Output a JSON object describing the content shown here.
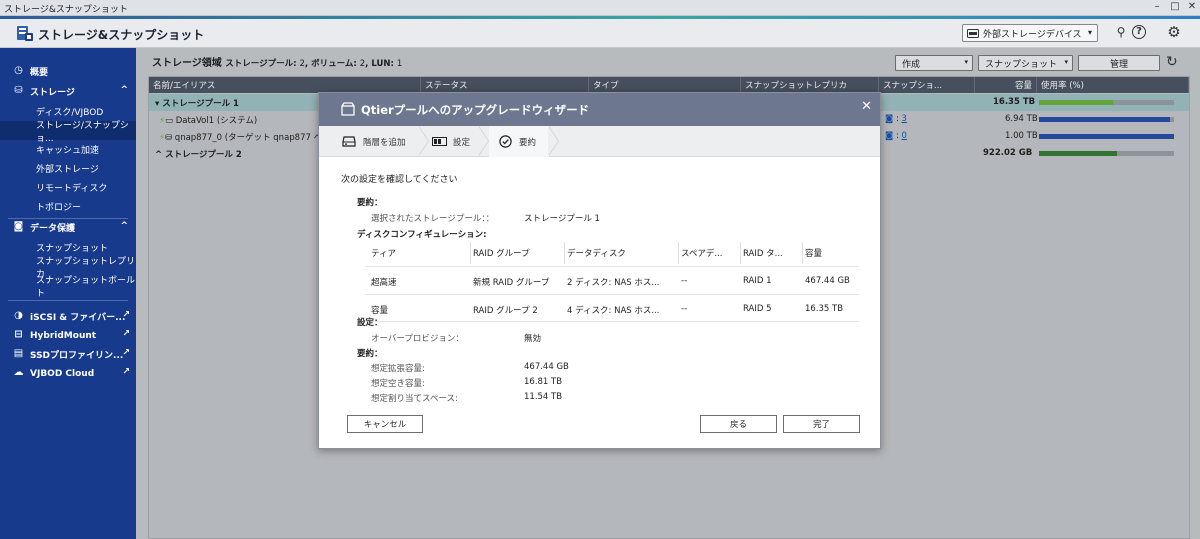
{
  "window": {
    "title": "ストレージ&スナップショット"
  },
  "header": {
    "app_title": "ストレージ&スナップショット",
    "ext_device_label": "外部ストレージデバイス"
  },
  "sidebar": {
    "overview": "概要",
    "storage": "ストレージ",
    "storage_items": [
      "ディスク/VJBOD",
      "ストレージ/スナップショ...",
      "キャッシュ加速",
      "外部ストレージ",
      "リモートディスク",
      "トポロジー"
    ],
    "data_protection": "データ保護",
    "protection_items": [
      "スナップショット",
      "スナップショットレプリカ",
      "スナップショットボールト"
    ],
    "external_items": [
      "iSCSI & ファイバー...",
      "HybridMount",
      "SSDプロファイリン...",
      "VJBOD Cloud"
    ]
  },
  "main": {
    "title": "ストレージ領域",
    "summary_pools_label": "ストレージプール:",
    "summary_pools": "2",
    "summary_volumes_label": "ボリューム:",
    "summary_volumes": "2",
    "summary_luns_label": "LUN:",
    "summary_luns": "1",
    "buttons": {
      "create": "作成",
      "snapshot": "スナップショット",
      "manage": "管理"
    },
    "columns": [
      "名前/エイリアス",
      "ステータス",
      "タイプ",
      "スナップショットレプリカ",
      "スナップショ...",
      "容量",
      "使用率 (%)"
    ],
    "rows": [
      {
        "name": "ストレージプール 1",
        "snap": "",
        "capacity": "16.35 TB",
        "usage": 0.55
      },
      {
        "name": "DataVol1 (システム)",
        "snap": "3",
        "capacity": "6.94 TB",
        "usage": 0.97
      },
      {
        "name": "qnap877_0 (ターゲット qnap877 へ",
        "snap": "0",
        "capacity": "1.00 TB",
        "usage": 1.0
      },
      {
        "name": "ストレージプール 2",
        "snap": "",
        "capacity": "922.02 GB",
        "usage": 0.58
      }
    ]
  },
  "dialog": {
    "title": "Qtierプールへのアップグレードウィザード",
    "steps": [
      "階層を追加",
      "設定",
      "要約"
    ],
    "confirm_text": "次の設定を確認してください",
    "summary_label": "要約：",
    "selected_pool_label": "選択されたストレージプール：：",
    "selected_pool_value": "ストレージプール 1",
    "disk_config_label": "ディスクコンフィギュレーション:",
    "table_headers": [
      "ティア",
      "RAID グループ",
      "データディスク",
      "スペアデ...",
      "RAID タ...",
      "容量"
    ],
    "table_rows": [
      [
        "超高速",
        "新規 RAID グループ",
        "2 ディスク: NAS ホス...",
        "--",
        "RAID 1",
        "467.44 GB"
      ],
      [
        "容量",
        "RAID グループ 2",
        "4 ディスク: NAS ホス...",
        "--",
        "RAID 5",
        "16.35 TB"
      ]
    ],
    "settings_label": "設定：",
    "overprovision_label": "オーバープロビジョン：",
    "overprovision_value": "無効",
    "summary2_label": "要約：",
    "expected_expansion_label": "想定拡張容量:",
    "expected_expansion_value": "467.44 GB",
    "expected_free_label": "想定空き容量:",
    "expected_free_value": "16.81 TB",
    "expected_alloc_label": "想定割り当てスペース:",
    "expected_alloc_value": "11.54 TB",
    "cancel": "キャンセル",
    "back": "戻る",
    "finish": "完了"
  }
}
